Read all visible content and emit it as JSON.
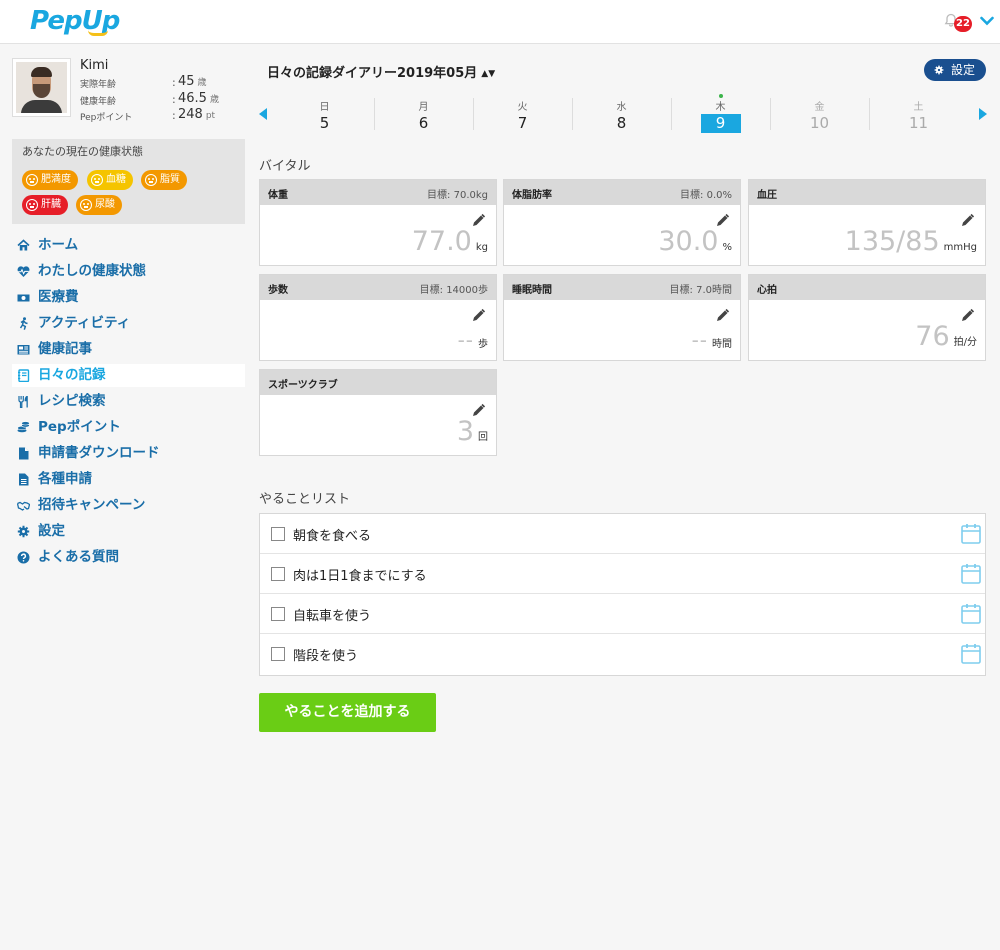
{
  "app": {
    "logo": "PepUp"
  },
  "header": {
    "notification_count": "22"
  },
  "profile": {
    "name": "Kimi",
    "rows": [
      {
        "label": "実際年齢",
        "value": "45",
        "unit": "歳"
      },
      {
        "label": "健康年齢",
        "value": "46.5",
        "unit": "歳"
      },
      {
        "label": "Pepポイント",
        "value": "248",
        "unit": "pt"
      }
    ]
  },
  "health": {
    "title": "あなたの現在の健康状態",
    "chips": [
      {
        "label": "肥満度",
        "color": "#f39800"
      },
      {
        "label": "血糖",
        "color": "#f5c400"
      },
      {
        "label": "脂質",
        "color": "#f39800"
      },
      {
        "label": "肝臓",
        "color": "#e61e28"
      },
      {
        "label": "尿酸",
        "color": "#f39800"
      }
    ]
  },
  "nav": [
    {
      "label": "ホーム",
      "icon": "home-icon"
    },
    {
      "label": "わたしの健康状態",
      "icon": "heartbeat-icon"
    },
    {
      "label": "医療費",
      "icon": "money-icon"
    },
    {
      "label": "アクティビティ",
      "icon": "running-icon"
    },
    {
      "label": "健康記事",
      "icon": "newspaper-icon"
    },
    {
      "label": "日々の記録",
      "icon": "notebook-icon",
      "active": true
    },
    {
      "label": "レシピ検索",
      "icon": "utensils-icon"
    },
    {
      "label": "Pepポイント",
      "icon": "coins-icon"
    },
    {
      "label": "申請書ダウンロード",
      "icon": "file-icon"
    },
    {
      "label": "各種申請",
      "icon": "document-icon"
    },
    {
      "label": "招待キャンペーン",
      "icon": "handshake-icon"
    },
    {
      "label": "設定",
      "icon": "gear-icon"
    },
    {
      "label": "よくある質問",
      "icon": "question-icon"
    }
  ],
  "diary": {
    "title": "日々の記録ダイアリー2019年05月",
    "settings_label": "設定"
  },
  "week": [
    {
      "name": "日",
      "num": "5"
    },
    {
      "name": "月",
      "num": "6"
    },
    {
      "name": "火",
      "num": "7"
    },
    {
      "name": "水",
      "num": "8"
    },
    {
      "name": "木",
      "num": "9",
      "selected": true
    },
    {
      "name": "金",
      "num": "10",
      "future": true
    },
    {
      "name": "土",
      "num": "11",
      "future": true
    }
  ],
  "vitals": {
    "title": "バイタル",
    "cards": [
      {
        "title": "体重",
        "goal": "目標: 70.0kg",
        "value": "77.0",
        "unit": "kg"
      },
      {
        "title": "体脂肪率",
        "goal": "目標: 0.0%",
        "value": "30.0",
        "unit": "%"
      },
      {
        "title": "血圧",
        "goal": "",
        "value": "135/85",
        "unit": "mmHg"
      },
      {
        "title": "歩数",
        "goal": "目標: 14000歩",
        "value": "--",
        "unit": "歩"
      },
      {
        "title": "睡眠時間",
        "goal": "目標: 7.0時間",
        "value": "--",
        "unit": "時間"
      },
      {
        "title": "心拍",
        "goal": "",
        "value": "76",
        "unit": "拍/分"
      },
      {
        "title": "スポーツクラブ",
        "goal": "",
        "value": "3",
        "unit": "回"
      }
    ]
  },
  "todo": {
    "title": "やることリスト",
    "items": [
      "朝食を食べる",
      "肉は1日1食までにする",
      "自転車を使う",
      "階段を使う"
    ],
    "add_label": "やることを追加する"
  }
}
